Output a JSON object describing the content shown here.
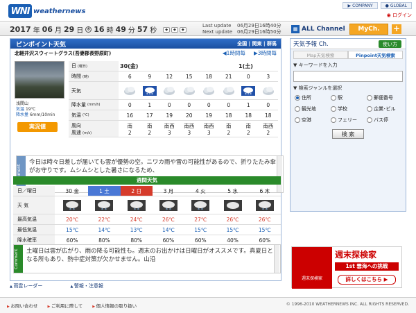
{
  "brand": {
    "logo": "WNI",
    "name": "weathernews"
  },
  "toplinks": [
    "COMPANY",
    "GLOBAL"
  ],
  "login": "ログイン",
  "datetime": {
    "year": "2017",
    "y_unit": "年",
    "month": "06",
    "m_unit": "月",
    "day": "29",
    "d_unit": "日",
    "weekday": "木",
    "hour": "16",
    "h_unit": "時",
    "minute": "49",
    "min_unit": "分",
    "second": "57",
    "s_unit": "秒"
  },
  "updates": {
    "last_label": "Last update",
    "last_value": "06月29日16時40分",
    "next_label": "Next update",
    "next_value": "06月29日16時50分"
  },
  "channels": {
    "all": "ALL Channel",
    "my": "MyCh.",
    "plus": "+"
  },
  "main": {
    "title": "ピンポイント天気",
    "crumb": "全国 | 関東 | 群馬",
    "location": "北軽井沢スウィートグラス(吾妻郡長野原町)",
    "prev": "1時間每",
    "next": "3時間每",
    "camera": {
      "name": "浅間山",
      "temp_label": "気温",
      "temp": "19℃",
      "wind_label": "降水量",
      "wind": "6mm/10min",
      "live": "実況値"
    },
    "rows": {
      "date": "日",
      "date_s": "(曜日)",
      "time": "時間",
      "time_s": "(時)",
      "weather": "天気",
      "precip": "降水量",
      "precip_s": "(mm/h)",
      "temp": "気温",
      "temp_s": "(℃)",
      "wind": "風向",
      "wind2": "風速",
      "wind_s": "(m/s)"
    },
    "days": [
      "30(金)",
      "1(土)"
    ],
    "hours": [
      "6",
      "9",
      "12",
      "15",
      "18",
      "21",
      "0",
      "3"
    ],
    "precip": [
      "0",
      "1",
      "0",
      "0",
      "0",
      "0",
      "1",
      "0"
    ],
    "temps": [
      "16",
      "17",
      "19",
      "20",
      "19",
      "18",
      "18",
      "18"
    ],
    "wdir": [
      "南",
      "南",
      "南西",
      "南西",
      "南西",
      "南",
      "南",
      "南西"
    ],
    "wspd": [
      "2",
      "2",
      "3",
      "3",
      "3",
      "2",
      "2",
      "2"
    ],
    "comment_label": "Comment",
    "comment": "今日は時々日差しが届いても雲が優勢の空。ニワカ雨や雷の可能性があるので、折りたたみ傘がお守りです。ムシムシとした暑さになるため、",
    "week": {
      "bar": "週間天気",
      "date_label": "日／曜日",
      "days": [
        "30 金",
        "1 土",
        "2 日",
        "3 月",
        "4 火",
        "5 水",
        "6 木"
      ],
      "weather_label": "天 気",
      "max_label": "最高気温",
      "max": [
        "20℃",
        "22℃",
        "24℃",
        "26℃",
        "27℃",
        "26℃",
        "26℃"
      ],
      "min_label": "最低気温",
      "min": [
        "15℃",
        "14℃",
        "13℃",
        "14℃",
        "15℃",
        "15℃",
        "15℃"
      ],
      "rain_label": "降水確率",
      "rain": [
        "60%",
        "80%",
        "80%",
        "60%",
        "60%",
        "40%",
        "60%"
      ],
      "comment": "土曜日は雲が広がり、雨の降る可能性も。週末のお出かけは日曜日がオススメです。真夏日となる所もあり、熱中症対策が欠かせません。山沿"
    }
  },
  "bottomlinks": [
    "雨雲レーダー",
    "警報・注意報"
  ],
  "footer": {
    "links": [
      "お問い合わせ",
      "ご利用に際して",
      "個人情報の取り扱い"
    ],
    "copy": "© 1996-2010 WEATHERNEWS INC. ALL RIGHTS RESERVED."
  },
  "right": {
    "title": "天気予報 Ch.",
    "use": "使い方",
    "tabs": [
      "Map天気検索",
      "Pinpoint天気検索"
    ],
    "kw_label": "▼ キーワードを入力",
    "genre_label": "▼ 検索ジャンルを選択",
    "options": [
      "住所",
      "駅",
      "郵便番号",
      "観光地",
      "学校",
      "企業･ビル",
      "空港",
      "フェリー",
      "バス停"
    ],
    "search": "検 索"
  },
  "ad": {
    "title": "週末探検家",
    "sub": "1st 雲海への挑戦",
    "cta": "詳しくはこちら ▶",
    "brand": "週末探検家"
  }
}
